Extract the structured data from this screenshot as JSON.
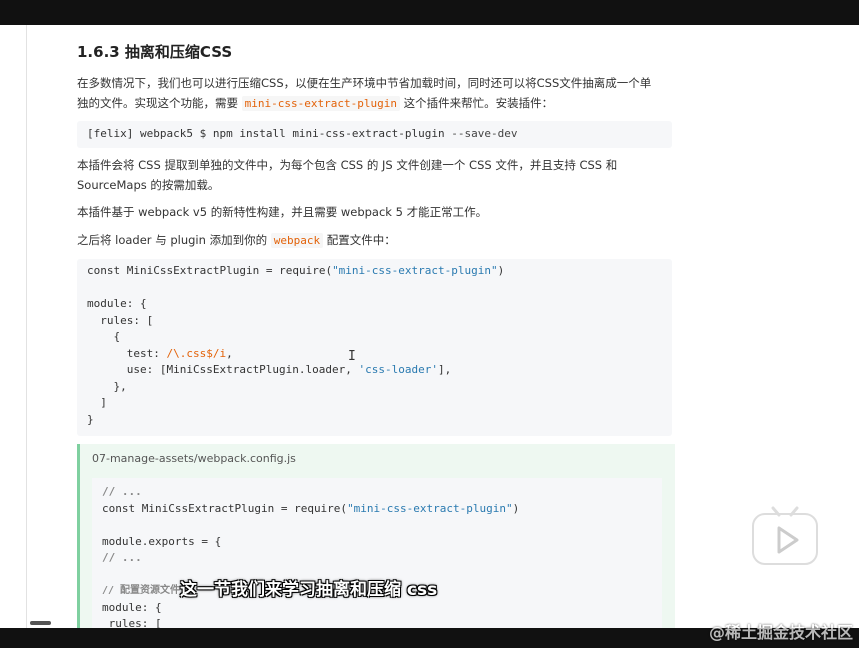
{
  "heading": "1.6.3 抽离和压缩CSS",
  "intro_line1": "在多数情况下，我们也可以进行压缩CSS，以便在生产环境中节省加载时间，同时还可以将CSS文件抽离成一个单",
  "intro_line2_prefix": "独的文件。实现这个功能，需要 ",
  "intro_code": "mini-css-extract-plugin",
  "intro_line2_suffix": " 这个插件来帮忙。安装插件：",
  "install_cmd": {
    "prompt": "[felix] webpack5 $ ",
    "cmd": "npm install mini-css-extract-plugin ",
    "flag": "--save-dev"
  },
  "para2_line1": "本插件会将 CSS 提取到单独的文件中，为每个包含 CSS 的 JS 文件创建一个 CSS 文件，并且支持 CSS 和",
  "para2_line2": "SourceMaps 的按需加载。",
  "para3": "本插件基于 webpack v5 的新特性构建，并且需要 webpack 5 才能正常工作。",
  "para4_prefix": "之后将 loader 与 plugin 添加到你的 ",
  "para4_code": "webpack",
  "para4_suffix": " 配置文件中：",
  "code1": [
    {
      "a": "const ",
      "b": "MiniCssExtractPlugin",
      "c": " = ",
      "d": "require",
      "e": "(",
      "s": "\"mini-css-extract-plugin\"",
      "f": ")"
    },
    {
      "text": ""
    },
    {
      "text": "module: {"
    },
    {
      "text": "  rules: ["
    },
    {
      "text": "    {"
    },
    {
      "p": "      test: ",
      "r": "/\\.css$/i",
      "t": ","
    },
    {
      "p": "      use: [MiniCssExtractPlugin.loader, ",
      "s": "'css-loader'",
      "t": "],"
    },
    {
      "text": "    },"
    },
    {
      "text": "  ]"
    },
    {
      "text": "}"
    }
  ],
  "file_tag": "07-manage-assets/webpack.config.js",
  "code2": {
    "c1": "// ...",
    "l2a": "const ",
    "l2b": "MiniCssExtractPlugin",
    "l2c": " = require(",
    "l2s": "\"mini-css-extract-plugin\"",
    "l2d": ")",
    "l4": "module.exports = {",
    "l5": "// ...",
    "l7": "// 配置资源文件",
    "l8": "module: {",
    "l9": " rules: ["
  },
  "subtitle": "这一节我们来学习抽离和压缩 css",
  "watermark": "@稀土掘金技术社区",
  "icons": {
    "play": "play-icon",
    "cursor": "text-cursor-icon"
  }
}
